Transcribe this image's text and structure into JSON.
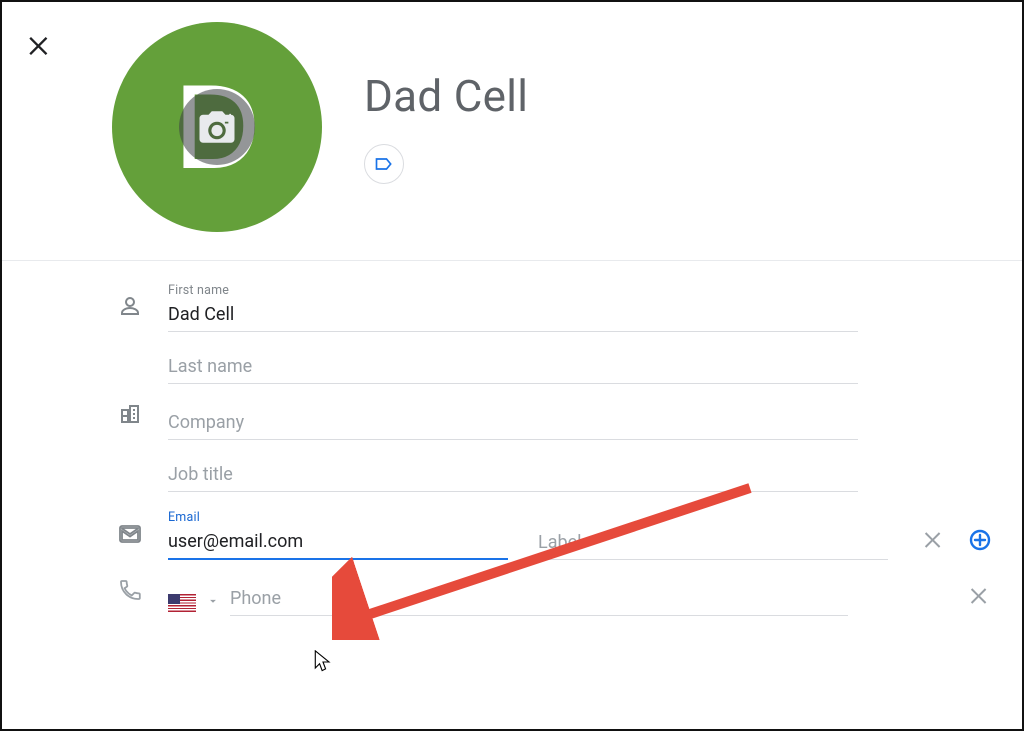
{
  "header": {
    "contact_name": "Dad Cell",
    "avatar_letter": "D"
  },
  "fields": {
    "first_name": {
      "label": "First name",
      "value": "Dad Cell"
    },
    "last_name": {
      "label": "Last name",
      "value": ""
    },
    "company": {
      "label": "Company",
      "value": ""
    },
    "job_title": {
      "label": "Job title",
      "value": ""
    },
    "email": {
      "label": "Email",
      "value": "user@email.com"
    },
    "email_label": {
      "placeholder": "Label",
      "value": ""
    },
    "phone": {
      "placeholder": "Phone",
      "value": ""
    }
  }
}
